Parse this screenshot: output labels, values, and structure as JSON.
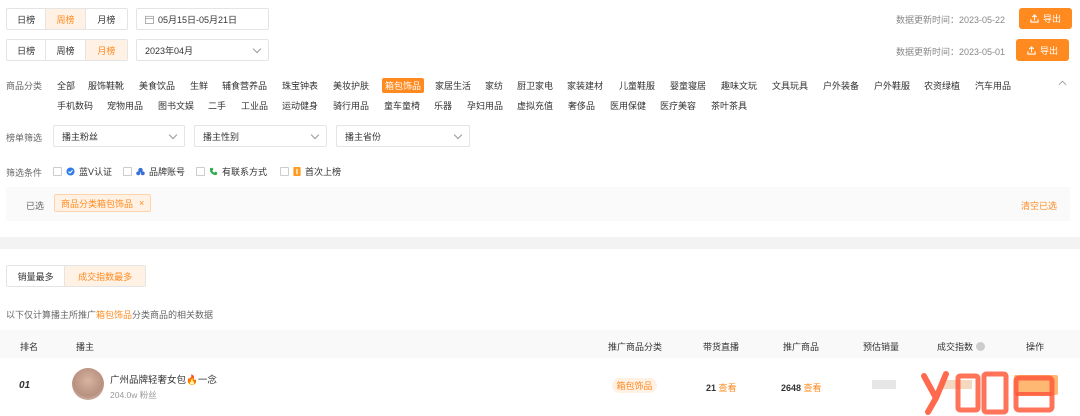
{
  "row1": {
    "tabs": [
      "日榜",
      "周榜",
      "月榜"
    ],
    "active_tab": "周榜",
    "date_range": "05月15日-05月21日",
    "update_label": "数据更新时间：2023-05-22",
    "export_label": "导出"
  },
  "row2": {
    "tabs": [
      "日榜",
      "周榜",
      "月榜"
    ],
    "active_tab": "月榜",
    "month_value": "2023年04月",
    "update_label": "数据更新时间：2023-05-01",
    "export_label": "导出"
  },
  "category": {
    "label": "商品分类",
    "line1": [
      "全部",
      "服饰鞋靴",
      "美食饮品",
      "生鲜",
      "辅食营养品",
      "珠宝钟表",
      "美妆护肤",
      "箱包饰品",
      "家居生活",
      "家纺",
      "厨卫家电",
      "家装建材",
      "儿童鞋服",
      "婴童寝居",
      "趣味文玩",
      "文具玩具",
      "户外装备",
      "户外鞋服",
      "农资绿植",
      "汽车用品"
    ],
    "line2": [
      "手机数码",
      "宠物用品",
      "图书文娱",
      "二手",
      "工业品",
      "运动健身",
      "骑行用品",
      "童车童椅",
      "乐器",
      "孕妇用品",
      "虚拟充值",
      "奢侈品",
      "医用保健",
      "医疗美容",
      "茶叶茶具"
    ],
    "active": "箱包饰品"
  },
  "filters": {
    "label": "榜单筛选",
    "selects": [
      "播主粉丝",
      "播主性别",
      "播主省份"
    ]
  },
  "conditions": {
    "label": "筛选条件",
    "items": [
      "蓝V认证",
      "品牌账号",
      "有联系方式",
      "首次上榜"
    ]
  },
  "selected": {
    "label": "已选",
    "tag": "商品分类箱包饰品",
    "tag_close": "×",
    "clear": "清空已选"
  },
  "sort_tabs": [
    "销量最多",
    "成交指数最多"
  ],
  "active_sort": "成交指数最多",
  "note": {
    "prefix": "以下仅计算播主所推广",
    "highlight": "箱包饰品",
    "suffix": "分类商品的相关数据"
  },
  "table": {
    "headers": [
      "排名",
      "播主",
      "推广商品分类",
      "带货直播",
      "推广商品",
      "预估销量",
      "成交指数",
      "操作"
    ],
    "rows": [
      {
        "rank": "01",
        "name": "广州品牌轻奢女包🔥一念",
        "fans": "204.0w 粉丝",
        "category": "箱包饰品",
        "live_count": "21",
        "live_link": "查看",
        "product_count": "2648",
        "product_link": "查看"
      }
    ]
  },
  "colors": {
    "accent": "#ff8a1f",
    "accent_bg": "#fff1e4"
  }
}
